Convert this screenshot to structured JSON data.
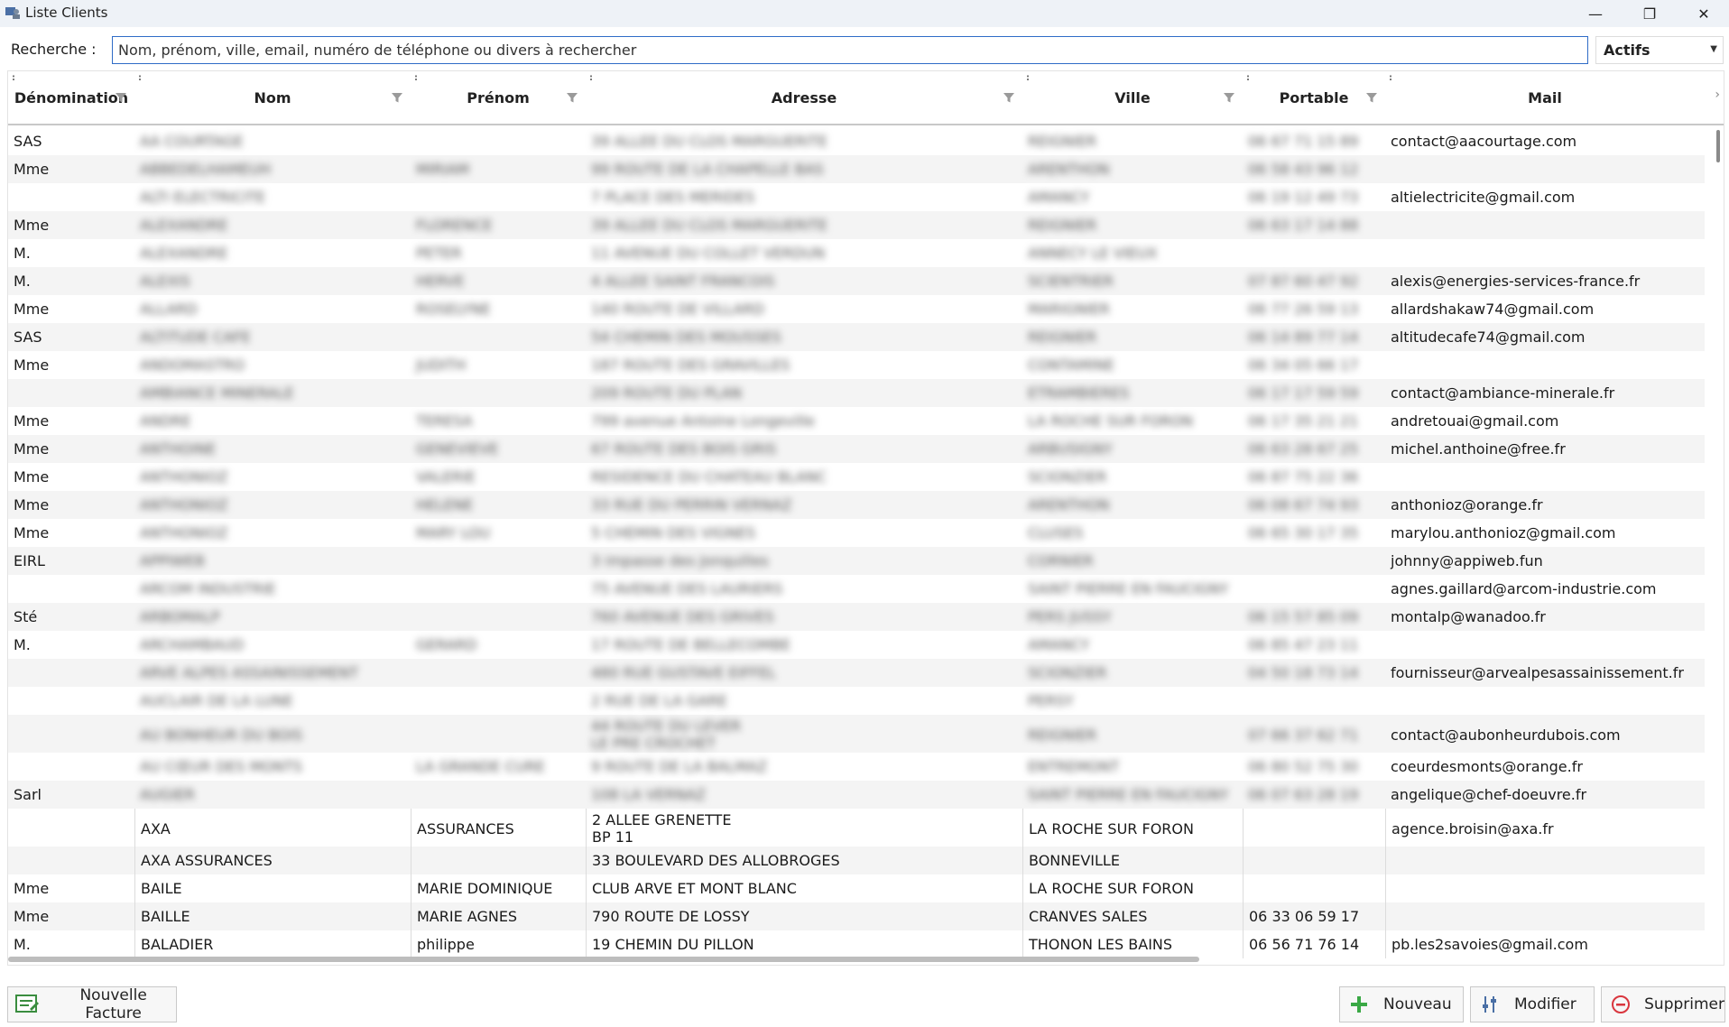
{
  "window": {
    "title": "Liste Clients",
    "minimize": "—",
    "restore": "❐",
    "close": "✕"
  },
  "search": {
    "label": "Recherche :",
    "value": "",
    "placeholder": "Nom, prénom, ville, email, numéro de téléphone ou divers à rechercher"
  },
  "status_filter": {
    "selected": "Actifs"
  },
  "columns": [
    "Dénomination",
    "Nom",
    "Prénom",
    "Adresse",
    "Ville",
    "Portable",
    "Mail"
  ],
  "blurred_rows": [
    {
      "denomination": "SAS",
      "nom": "AA COURTAGE",
      "prenom": "",
      "adresse": "39 ALLEE DU CLOS MARGUERITE",
      "ville": "REIGNIER",
      "portable": "06 67 71 15 89",
      "mail": "contact@aacourtage.com"
    },
    {
      "denomination": "Mme",
      "nom": "ABBEDELHAMEUH",
      "prenom": "MIRIAM",
      "adresse": "99 ROUTE DE LA CHAPELLE BAS",
      "ville": "ARENTHON",
      "portable": "06 58 43 96 12",
      "mail": ""
    },
    {
      "denomination": "",
      "nom": "ALTI ELECTRICITE",
      "prenom": "",
      "adresse": "7 PLACE DES MERIDES",
      "ville": "AMANCY",
      "portable": "06 19 12 49 73",
      "mail": "altielectricite@gmail.com"
    },
    {
      "denomination": "Mme",
      "nom": "ALEXANDRE",
      "prenom": "FLORENCE",
      "adresse": "39 ALLEE DU CLOS MARGUERITE",
      "ville": "REIGNIER",
      "portable": "06 63 17 14 88",
      "mail": ""
    },
    {
      "denomination": "M.",
      "nom": "ALEXANDRE",
      "prenom": "PETER",
      "adresse": "11 AVENUE DU COLLET VERDUN",
      "ville": "ANNECY LE VIEUX",
      "portable": "",
      "mail": ""
    },
    {
      "denomination": "M.",
      "nom": "ALEXIS",
      "prenom": "HERVE",
      "adresse": "4 ALLEE SAINT FRANCOIS",
      "ville": "SCIENTRIER",
      "portable": "07 87 60 47 92",
      "mail": "alexis@energies-services-france.fr"
    },
    {
      "denomination": "Mme",
      "nom": "ALLARD",
      "prenom": "ROSELYNE",
      "adresse": "140 ROUTE DE VILLARD",
      "ville": "MARIGNIER",
      "portable": "06 77 26 59 13",
      "mail": "allardshakaw74@gmail.com"
    },
    {
      "denomination": "SAS",
      "nom": "ALTITUDE CAFE",
      "prenom": "",
      "adresse": "54 CHEMIN DES MOUSSES",
      "ville": "REIGNIER",
      "portable": "06 14 89 77 14",
      "mail": "altitudecafe74@gmail.com"
    },
    {
      "denomination": "Mme",
      "nom": "ANDOMASTRO",
      "prenom": "JUDITH",
      "adresse": "187 ROUTE DES GRAVILLES",
      "ville": "CONTAMINE",
      "portable": "06 34 05 66 17",
      "mail": ""
    },
    {
      "denomination": "",
      "nom": "AMBIANCE MINERALE",
      "prenom": "",
      "adresse": "209 ROUTE DU PLAN",
      "ville": "ETRAMBIERES",
      "portable": "06 17 17 59 59",
      "mail": "contact@ambiance-minerale.fr"
    },
    {
      "denomination": "Mme",
      "nom": "ANDRE",
      "prenom": "TERESA",
      "adresse": "799 avenue Antoine Longeville",
      "ville": "LA ROCHE SUR FORON",
      "portable": "06 17 35 21 21",
      "mail": "andretouai@gmail.com"
    },
    {
      "denomination": "Mme",
      "nom": "ANTHOINE",
      "prenom": "GENEVIEVE",
      "adresse": "67 ROUTE DES BOIS GRIS",
      "ville": "ARBUSIGNY",
      "portable": "06 63 28 67 25",
      "mail": "michel.anthoine@free.fr"
    },
    {
      "denomination": "Mme",
      "nom": "ANTHONIOZ",
      "prenom": "VALERIE",
      "adresse": "RESIDENCE DU CHATEAU BLANC",
      "ville": "SCIONZIER",
      "portable": "06 87 75 22 36",
      "mail": ""
    },
    {
      "denomination": "Mme",
      "nom": "ANTHONIOZ",
      "prenom": "HELENE",
      "adresse": "33 RUE DU PERRIN VERNAZ",
      "ville": "ARENTHON",
      "portable": "06 08 67 74 93",
      "mail": "anthonioz@orange.fr"
    },
    {
      "denomination": "Mme",
      "nom": "ANTHONIOZ",
      "prenom": "MARY LOU",
      "adresse": "5 CHEMIN DES VIGNES",
      "ville": "CLUSES",
      "portable": "06 65 30 17 35",
      "mail": "marylou.anthonioz@gmail.com"
    },
    {
      "denomination": "EIRL",
      "nom": "APPIWEB",
      "prenom": "",
      "adresse": "3 impasse des Jonquilles",
      "ville": "CORNIER",
      "portable": "",
      "mail": "johnny@appiweb.fun"
    },
    {
      "denomination": "",
      "nom": "ARCOM INDUSTRIE",
      "prenom": "",
      "adresse": "75 AVENUE DES LAURIERS",
      "ville": "SAINT PIERRE EN FAUCIGNY",
      "portable": "",
      "mail": "agnes.gaillard@arcom-industrie.com"
    },
    {
      "denomination": "Sté",
      "nom": "ARBOMALP",
      "prenom": "",
      "adresse": "760 AVENUE DES GRIVES",
      "ville": "PERS JUSSY",
      "portable": "06 15 57 85 09",
      "mail": "montalp@wanadoo.fr"
    },
    {
      "denomination": "M.",
      "nom": "ARCHAMBAUD",
      "prenom": "GERARD",
      "adresse": "17 ROUTE DE BELLECOMBE",
      "ville": "AMANCY",
      "portable": "06 85 47 23 11",
      "mail": ""
    },
    {
      "denomination": "",
      "nom": "ARVE ALPES ASSAINISSEMENT",
      "prenom": "",
      "adresse": "480 RUE GUSTAVE EIFFEL",
      "ville": "SCIONZIER",
      "portable": "04 50 18 73 14",
      "mail": "fournisseur@arvealpesassainissement.fr"
    },
    {
      "denomination": "",
      "nom": "AUCLAIR DE LA LUNE",
      "prenom": "",
      "adresse": "2 RUE DE LA GARE",
      "ville": "PERSY",
      "portable": "",
      "mail": ""
    },
    {
      "denomination": "",
      "nom": "AU BONHEUR DU BOIS",
      "prenom": "",
      "adresse": "44 ROUTE DU LEVER",
      "ville": "REIGNIER",
      "portable": "07 66 37 62 71",
      "mail": "contact@aubonheurdubois.com",
      "adresse2": "LE PRE CROCHET"
    },
    {
      "denomination": "",
      "nom": "AU CŒUR DES MONTS",
      "prenom": "LA GRANDE CURE",
      "adresse": "9 ROUTE DE LA BALMAZ",
      "ville": "ENTREMONT",
      "portable": "06 80 52 75 30",
      "mail": "coeurdesmonts@orange.fr"
    },
    {
      "denomination": "Sarl",
      "nom": "AUGIER",
      "prenom": "",
      "adresse": "108 LA VERNAZ",
      "ville": "SAINT PIERRE EN FAUCIGNY",
      "portable": "06 07 63 28 19",
      "mail": "angelique@chef-doeuvre.fr"
    }
  ],
  "rows": [
    {
      "denomination": "",
      "nom": "AXA",
      "prenom": "ASSURANCES",
      "adresse": "2 ALLEE GRENETTE",
      "adresse2": "BP 11",
      "ville": "LA ROCHE SUR FORON",
      "portable": "",
      "mail": "agence.broisin@axa.fr"
    },
    {
      "denomination": "",
      "nom": "AXA ASSURANCES",
      "prenom": "",
      "adresse": "33 BOULEVARD DES ALLOBROGES",
      "ville": "BONNEVILLE",
      "portable": "",
      "mail": ""
    },
    {
      "denomination": "Mme",
      "nom": "BAILE",
      "prenom": "MARIE DOMINIQUE",
      "adresse": "CLUB ARVE ET MONT BLANC",
      "ville": "LA ROCHE SUR FORON",
      "portable": "",
      "mail": ""
    },
    {
      "denomination": "Mme",
      "nom": "BAILLE",
      "prenom": "MARIE AGNES",
      "adresse": "790 ROUTE DE LOSSY",
      "ville": "CRANVES SALES",
      "portable": "06 33 06 59 17",
      "mail": ""
    },
    {
      "denomination": "M.",
      "nom": "BALADIER",
      "prenom": "philippe",
      "adresse": "19 CHEMIN DU PILLON",
      "ville": "THONON LES BAINS",
      "portable": "06 56 71 76 14",
      "mail": "pb.les2savoies@gmail.com"
    }
  ],
  "buttons": {
    "new_invoice": "Nouvelle Facture",
    "new": "Nouveau",
    "modify": "Modifier",
    "delete": "Supprimer"
  },
  "colors": {
    "accent": "#2f6cc7",
    "add_green": "#3aa845",
    "delete_red": "#d9363e",
    "row_alt": "#f4f4f4"
  }
}
